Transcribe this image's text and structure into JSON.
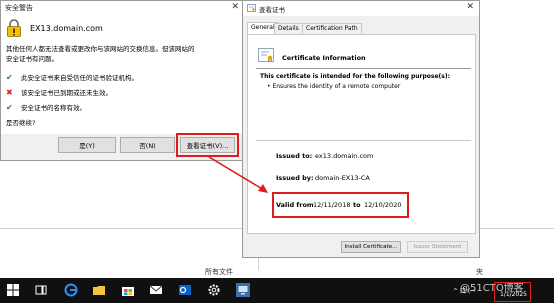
{
  "background": {
    "page_text": "所有文件",
    "page_text2": "夹"
  },
  "security_alert": {
    "title": "安全警告",
    "close": "✕",
    "domain": "EX13.domain.com",
    "description_line1": "其他任何人都无法查看或更改你与该网站的交换信息。但该网站的",
    "description_line2": "安全证书有问题。",
    "checks": [
      {
        "icon": "check-icon",
        "symbol": "✔",
        "color": "#2e8b2e",
        "text": "此安全证书来自受信任的证书验证机构。"
      },
      {
        "icon": "cross-icon",
        "symbol": "✖",
        "color": "#d42a2a",
        "text": "该安全证书已到期或还未生效。"
      },
      {
        "icon": "check-icon",
        "symbol": "✔",
        "color": "#2e8b2e",
        "text": "安全证书的名称有效。"
      }
    ],
    "question": "是否继续?",
    "buttons": {
      "yes": "是(Y)",
      "no": "否(N)",
      "view": "查看证书(V)..."
    }
  },
  "certificate": {
    "title": "查看证书",
    "close": "✕",
    "tabs": [
      "General",
      "Details",
      "Certification Path"
    ],
    "info_heading": "Certificate Information",
    "purpose_text": "This certificate is intended for the following purpose(s):",
    "purpose_items": [
      "• Ensures the identity of a remote computer"
    ],
    "issued_to_label": "Issued to:",
    "issued_to_value": "ex13.domain.com",
    "issued_by_label": "Issued by:",
    "issued_by_value": "domain-EX13-CA",
    "valid_from_label": "Valid from",
    "valid_from_value": "12/11/2018",
    "valid_to_label": "to",
    "valid_to_value": "12/10/2020",
    "buttons": {
      "install": "Install Certificate...",
      "issuer": "Issuer Statement"
    }
  },
  "taskbar": {
    "tray_text": "^ 口 (ꟷ",
    "date": "1/1/2025",
    "watermark": "@51CTO博客"
  },
  "colors": {
    "highlight": "#e01b1b",
    "taskbar": "#101010"
  }
}
